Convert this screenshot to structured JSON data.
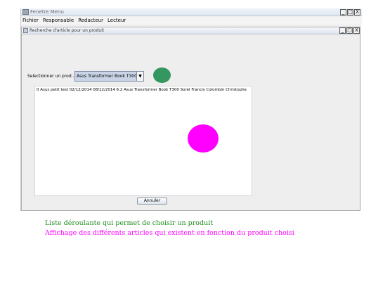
{
  "window": {
    "title": "Fenetre Menu",
    "controls": {
      "minimize": "_",
      "maximize": "□",
      "close": "X"
    }
  },
  "menubar": {
    "items": [
      "Fichier",
      "Responsable",
      "Redacteur",
      "Lecteur"
    ]
  },
  "inner_window": {
    "title": "Recherche d'article pour un produit",
    "controls": {
      "minimize": "_",
      "maximize": "□",
      "close": "X"
    }
  },
  "form": {
    "select_label": "Selectionner un prod...",
    "product_selected": "Asus Transformer Book T300",
    "dropdown_arrow": "▼"
  },
  "results": {
    "lines": [
      "0 Asus petit test 02/12/2014 08/12/2014 6.2 Asus Transformer Book T300 Sorel Francis Colombin Christophe"
    ]
  },
  "buttons": {
    "cancel_label": "Annuler"
  },
  "annotations": {
    "green": "Liste déroulante qui permet de choisir un produit",
    "magenta": "Affichage des différents articles qui existent en fonction du produit choisi"
  },
  "colors": {
    "green_marker": "#33975f",
    "magenta_marker": "#ff00ff",
    "green_text": "#228b22",
    "magenta_text": "#ff00ff"
  },
  "icons": [
    "app-icon",
    "frame-icon",
    "dropdown-arrow-icon"
  ]
}
